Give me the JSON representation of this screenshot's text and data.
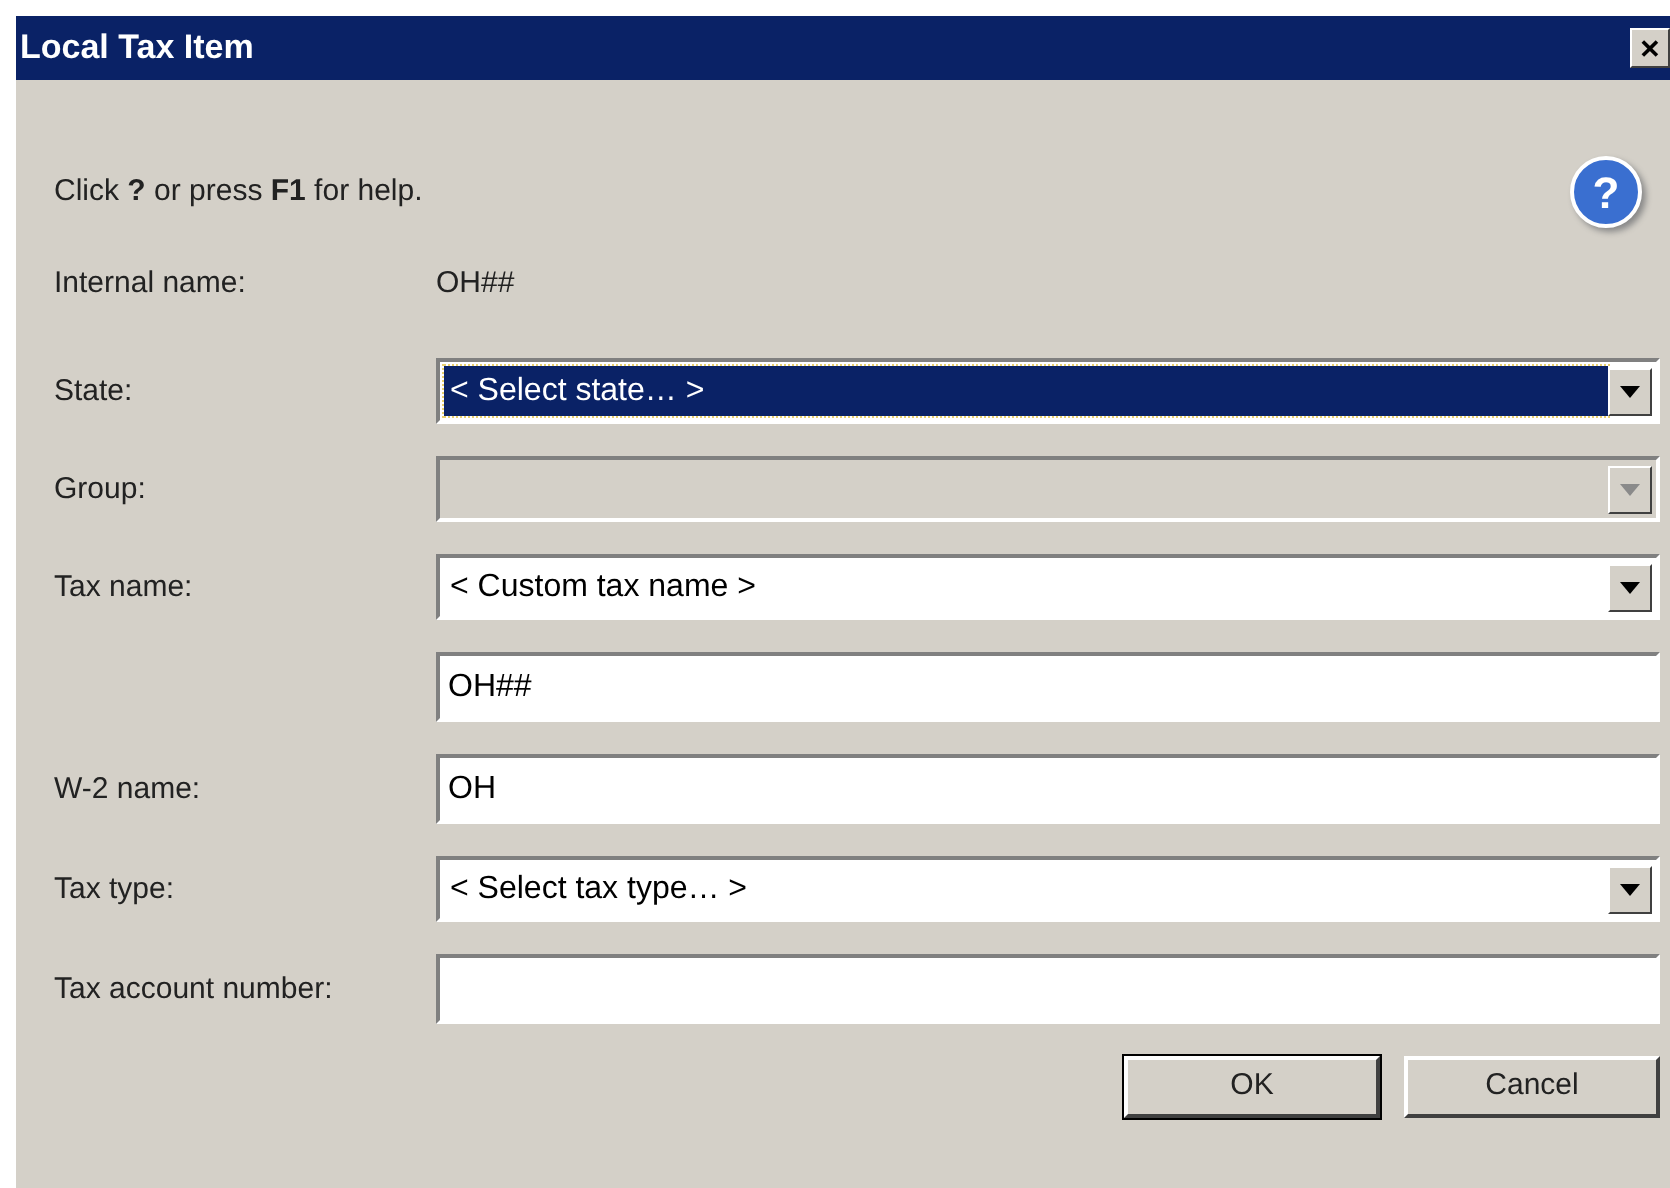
{
  "window": {
    "title": "Local Tax Item",
    "close": "✕"
  },
  "help_text": "Click **?** or press **F1** for help.",
  "help_icon": "?",
  "rows": [
    {
      "kind": "text",
      "label": "Internal name:",
      "value": "OH##"
    },
    {
      "kind": "combo",
      "label": "State:",
      "value": "< Select state… >",
      "highlighted": true,
      "disabled": false
    },
    {
      "kind": "combo",
      "label": "Group:",
      "highlighted": false,
      "disabled": true
    },
    {
      "kind": "combo",
      "label": "Tax name:",
      "value": "< Custom tax name >",
      "highlighted": false,
      "disabled": false
    },
    {
      "kind": "input",
      "value": "OH##"
    },
    {
      "kind": "input",
      "label": "W-2 name:",
      "value": "OH"
    },
    {
      "kind": "combo",
      "label": "Tax type:",
      "value": "< Select tax type… >",
      "highlighted": false,
      "disabled": false
    },
    {
      "kind": "input",
      "label": "Tax account number:"
    }
  ],
  "buttons": [
    {
      "label": "OK",
      "default": true
    },
    {
      "label": "Cancel",
      "default": false
    }
  ]
}
